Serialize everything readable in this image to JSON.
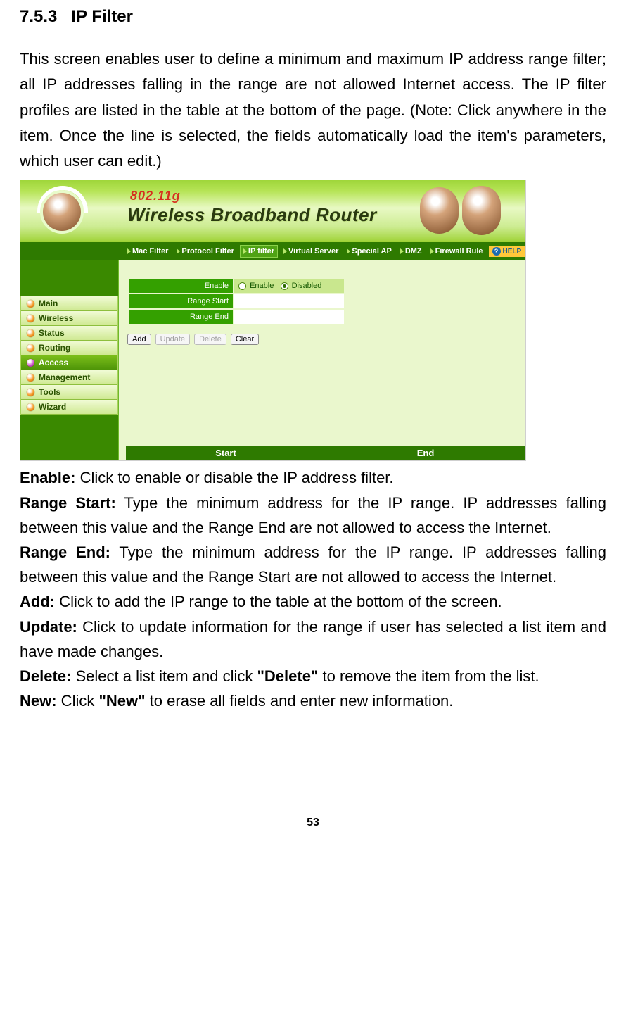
{
  "section": {
    "number": "7.5.3",
    "title": "IP Filter"
  },
  "intro": "This screen enables user to define a minimum and maximum IP address range filter; all IP addresses falling in the range are not allowed Internet access.   The IP filter profiles are listed in the table at the bottom of the page. (Note: Click anywhere in the item. Once the line is selected, the fields automatically load the item's parameters, which user can edit.)",
  "router": {
    "std": "802.11g",
    "product": "Wireless  Broadband  Router",
    "nav": [
      "Mac Filter",
      "Protocol Filter",
      "IP filter",
      "Virtual Server",
      "Special AP",
      "DMZ",
      "Firewall Rule"
    ],
    "nav_active_index": 2,
    "help": "HELP",
    "menu": [
      "Main",
      "Wireless",
      "Status",
      "Routing",
      "Access",
      "Management",
      "Tools",
      "Wizard"
    ],
    "menu_active_index": 4,
    "form": {
      "enable_label": "Enable",
      "opt_enable": "Enable",
      "opt_disabled": "Disabled",
      "range_start_label": "Range Start",
      "range_end_label": "Range End"
    },
    "buttons": {
      "add": "Add",
      "update": "Update",
      "delete": "Delete",
      "clear": "Clear"
    },
    "table": {
      "col_start": "Start",
      "col_end": "End"
    }
  },
  "definitions": {
    "enable": {
      "term": "Enable:",
      "text": " Click to enable or disable the IP address filter."
    },
    "range_start": {
      "term": "Range Start:",
      "text": " Type the minimum address for the IP range. IP addresses falling between this value and the Range End are not allowed to access the Internet."
    },
    "range_end": {
      "term": "Range End:",
      "text": " Type the minimum address for the IP range. IP addresses falling between this value and the Range Start are not allowed to access the Internet."
    },
    "add": {
      "term": "Add:",
      "text": " Click to add the IP range to the table at the bottom of the screen."
    },
    "update": {
      "term": "Update:",
      "text": " Click to update information for the range if user has selected a list item and have made changes."
    },
    "delete": {
      "term": "Delete:",
      "pre": " Select a list item and click ",
      "quoted": "\"Delete\"",
      "post": " to remove the item from the list."
    },
    "new_": {
      "term": "New:",
      "pre": " Click ",
      "quoted": "\"New\"",
      "post": " to erase all fields and enter new information."
    }
  },
  "page_number": "53"
}
